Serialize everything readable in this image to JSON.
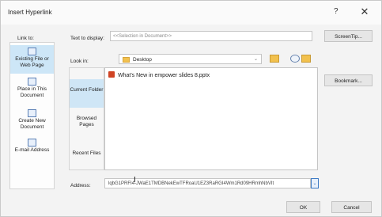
{
  "window": {
    "title": "Insert Hyperlink",
    "help": "?",
    "close": "✕"
  },
  "link_to": {
    "label": "Link to:",
    "items": [
      {
        "label": "Existing File or Web Page",
        "active": true
      },
      {
        "label": "Place in This Document"
      },
      {
        "label": "Create New Document"
      },
      {
        "label": "E-mail Address"
      }
    ]
  },
  "text_to_display": {
    "label": "Text to display:",
    "value": "<<Selection in Document>>"
  },
  "screentip_label": "ScreenTip...",
  "look_in": {
    "label": "Look in:",
    "value": "Desktop"
  },
  "left_pane": [
    "Current Folder",
    "Browsed Pages",
    "Recent Files"
  ],
  "files": [
    {
      "name": "What's New in empower slides 8.pptx"
    }
  ],
  "bookmark_label": "Bookmark...",
  "address": {
    "label": "Address:",
    "value": "lqbG1PRFI4-JWaE1TMDBNekEwTFRoaU1EZ3RaRGI4Wm1Rd09HRmhNbVIt"
  },
  "buttons": {
    "ok": "OK",
    "cancel": "Cancel"
  }
}
